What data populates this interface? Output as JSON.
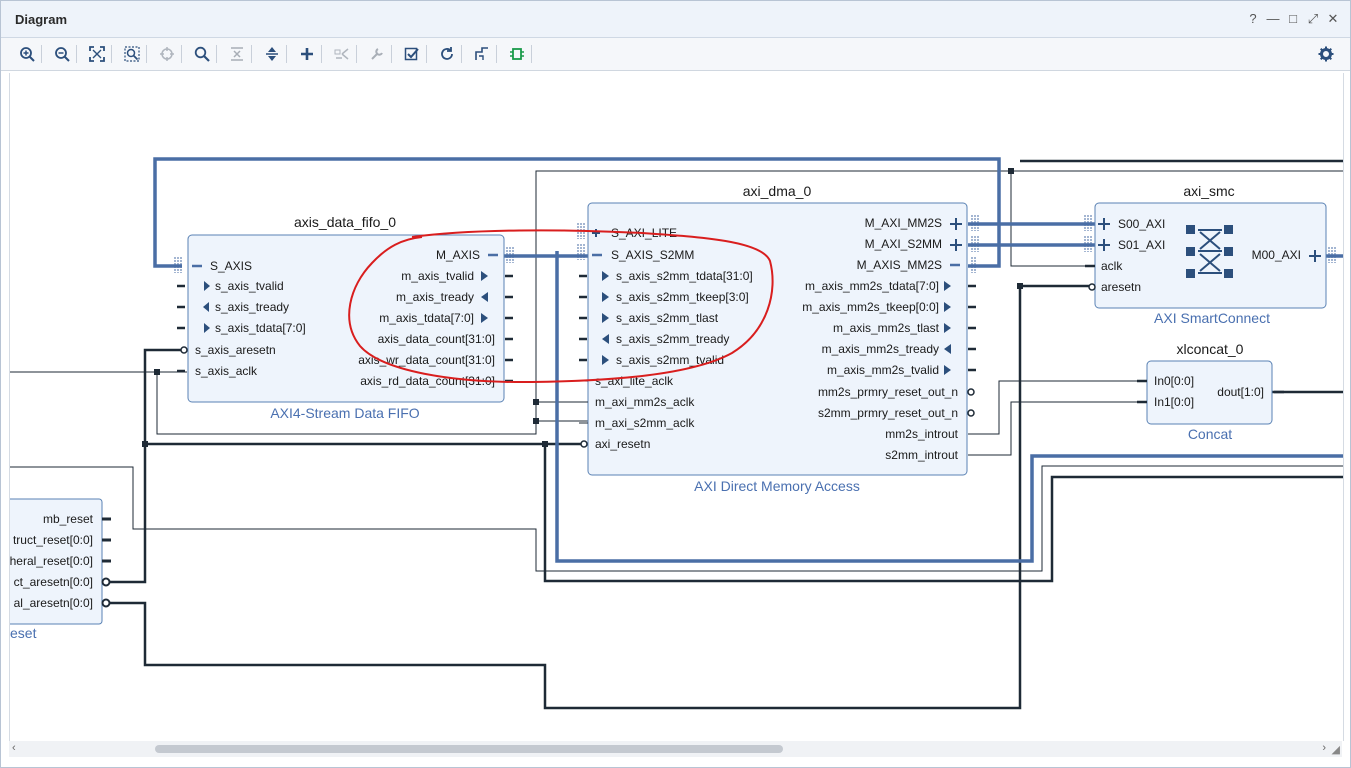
{
  "window": {
    "title": "Diagram",
    "controls": [
      "?",
      "—",
      "□",
      "⤢",
      "✕"
    ]
  },
  "toolbar": {
    "buttons": [
      "zoom-in",
      "zoom-out",
      "zoom-fit",
      "zoom-area",
      "center",
      "search",
      "collapse",
      "expand",
      "add-ip",
      "make-external",
      "properties",
      "validate",
      "regenerate",
      "optimize-routing",
      "auto-connect",
      "settings"
    ]
  },
  "blocks": {
    "fifo": {
      "instance": "axis_data_fifo_0",
      "type_label": "AXI4-Stream Data FIFO",
      "left_ports": [
        "S_AXIS",
        "s_axis_tvalid",
        "s_axis_tready",
        "s_axis_tdata[7:0]",
        "s_axis_aresetn",
        "s_axis_aclk"
      ],
      "right_ports": [
        "M_AXIS",
        "m_axis_tvalid",
        "m_axis_tready",
        "m_axis_tdata[7:0]",
        "axis_data_count[31:0]",
        "axis_wr_data_count[31:0]",
        "axis_rd_data_count[31:0]"
      ]
    },
    "dma": {
      "instance": "axi_dma_0",
      "type_label": "AXI Direct Memory Access",
      "left_ports": [
        "S_AXI_LITE",
        "S_AXIS_S2MM",
        "s_axis_s2mm_tdata[31:0]",
        "s_axis_s2mm_tkeep[3:0]",
        "s_axis_s2mm_tlast",
        "s_axis_s2mm_tready",
        "s_axis_s2mm_tvalid",
        "s_axi_lite_aclk",
        "m_axi_mm2s_aclk",
        "m_axi_s2mm_aclk",
        "axi_resetn"
      ],
      "right_ports": [
        "M_AXI_MM2S",
        "M_AXI_S2MM",
        "M_AXIS_MM2S",
        "m_axis_mm2s_tdata[7:0]",
        "m_axis_mm2s_tkeep[0:0]",
        "m_axis_mm2s_tlast",
        "m_axis_mm2s_tready",
        "m_axis_mm2s_tvalid",
        "mm2s_prmry_reset_out_n",
        "s2mm_prmry_reset_out_n",
        "mm2s_introut",
        "s2mm_introut"
      ]
    },
    "smc": {
      "instance": "axi_smc",
      "type_label": "AXI SmartConnect",
      "left_ports": [
        "S00_AXI",
        "S01_AXI",
        "aclk",
        "aresetn"
      ],
      "right_ports": [
        "M00_AXI"
      ]
    },
    "concat": {
      "instance": "xlconcat_0",
      "type_label": "Concat",
      "left_ports": [
        "In0[0:0]",
        "In1[0:0]"
      ],
      "right_ports": [
        "dout[1:0]"
      ]
    },
    "reset": {
      "type_label": "eset",
      "right_ports": [
        "mb_reset",
        "truct_reset[0:0]",
        "heral_reset[0:0]",
        "ct_aresetn[0:0]",
        "al_aresetn[0:0]"
      ]
    }
  },
  "colors": {
    "block_fill": "#eef4fc",
    "block_border": "#5a82b4",
    "bus": "#4a6ea5",
    "wire": "#1e2a36",
    "annotation": "#d91e1e",
    "type_label": "#4a70b0"
  }
}
